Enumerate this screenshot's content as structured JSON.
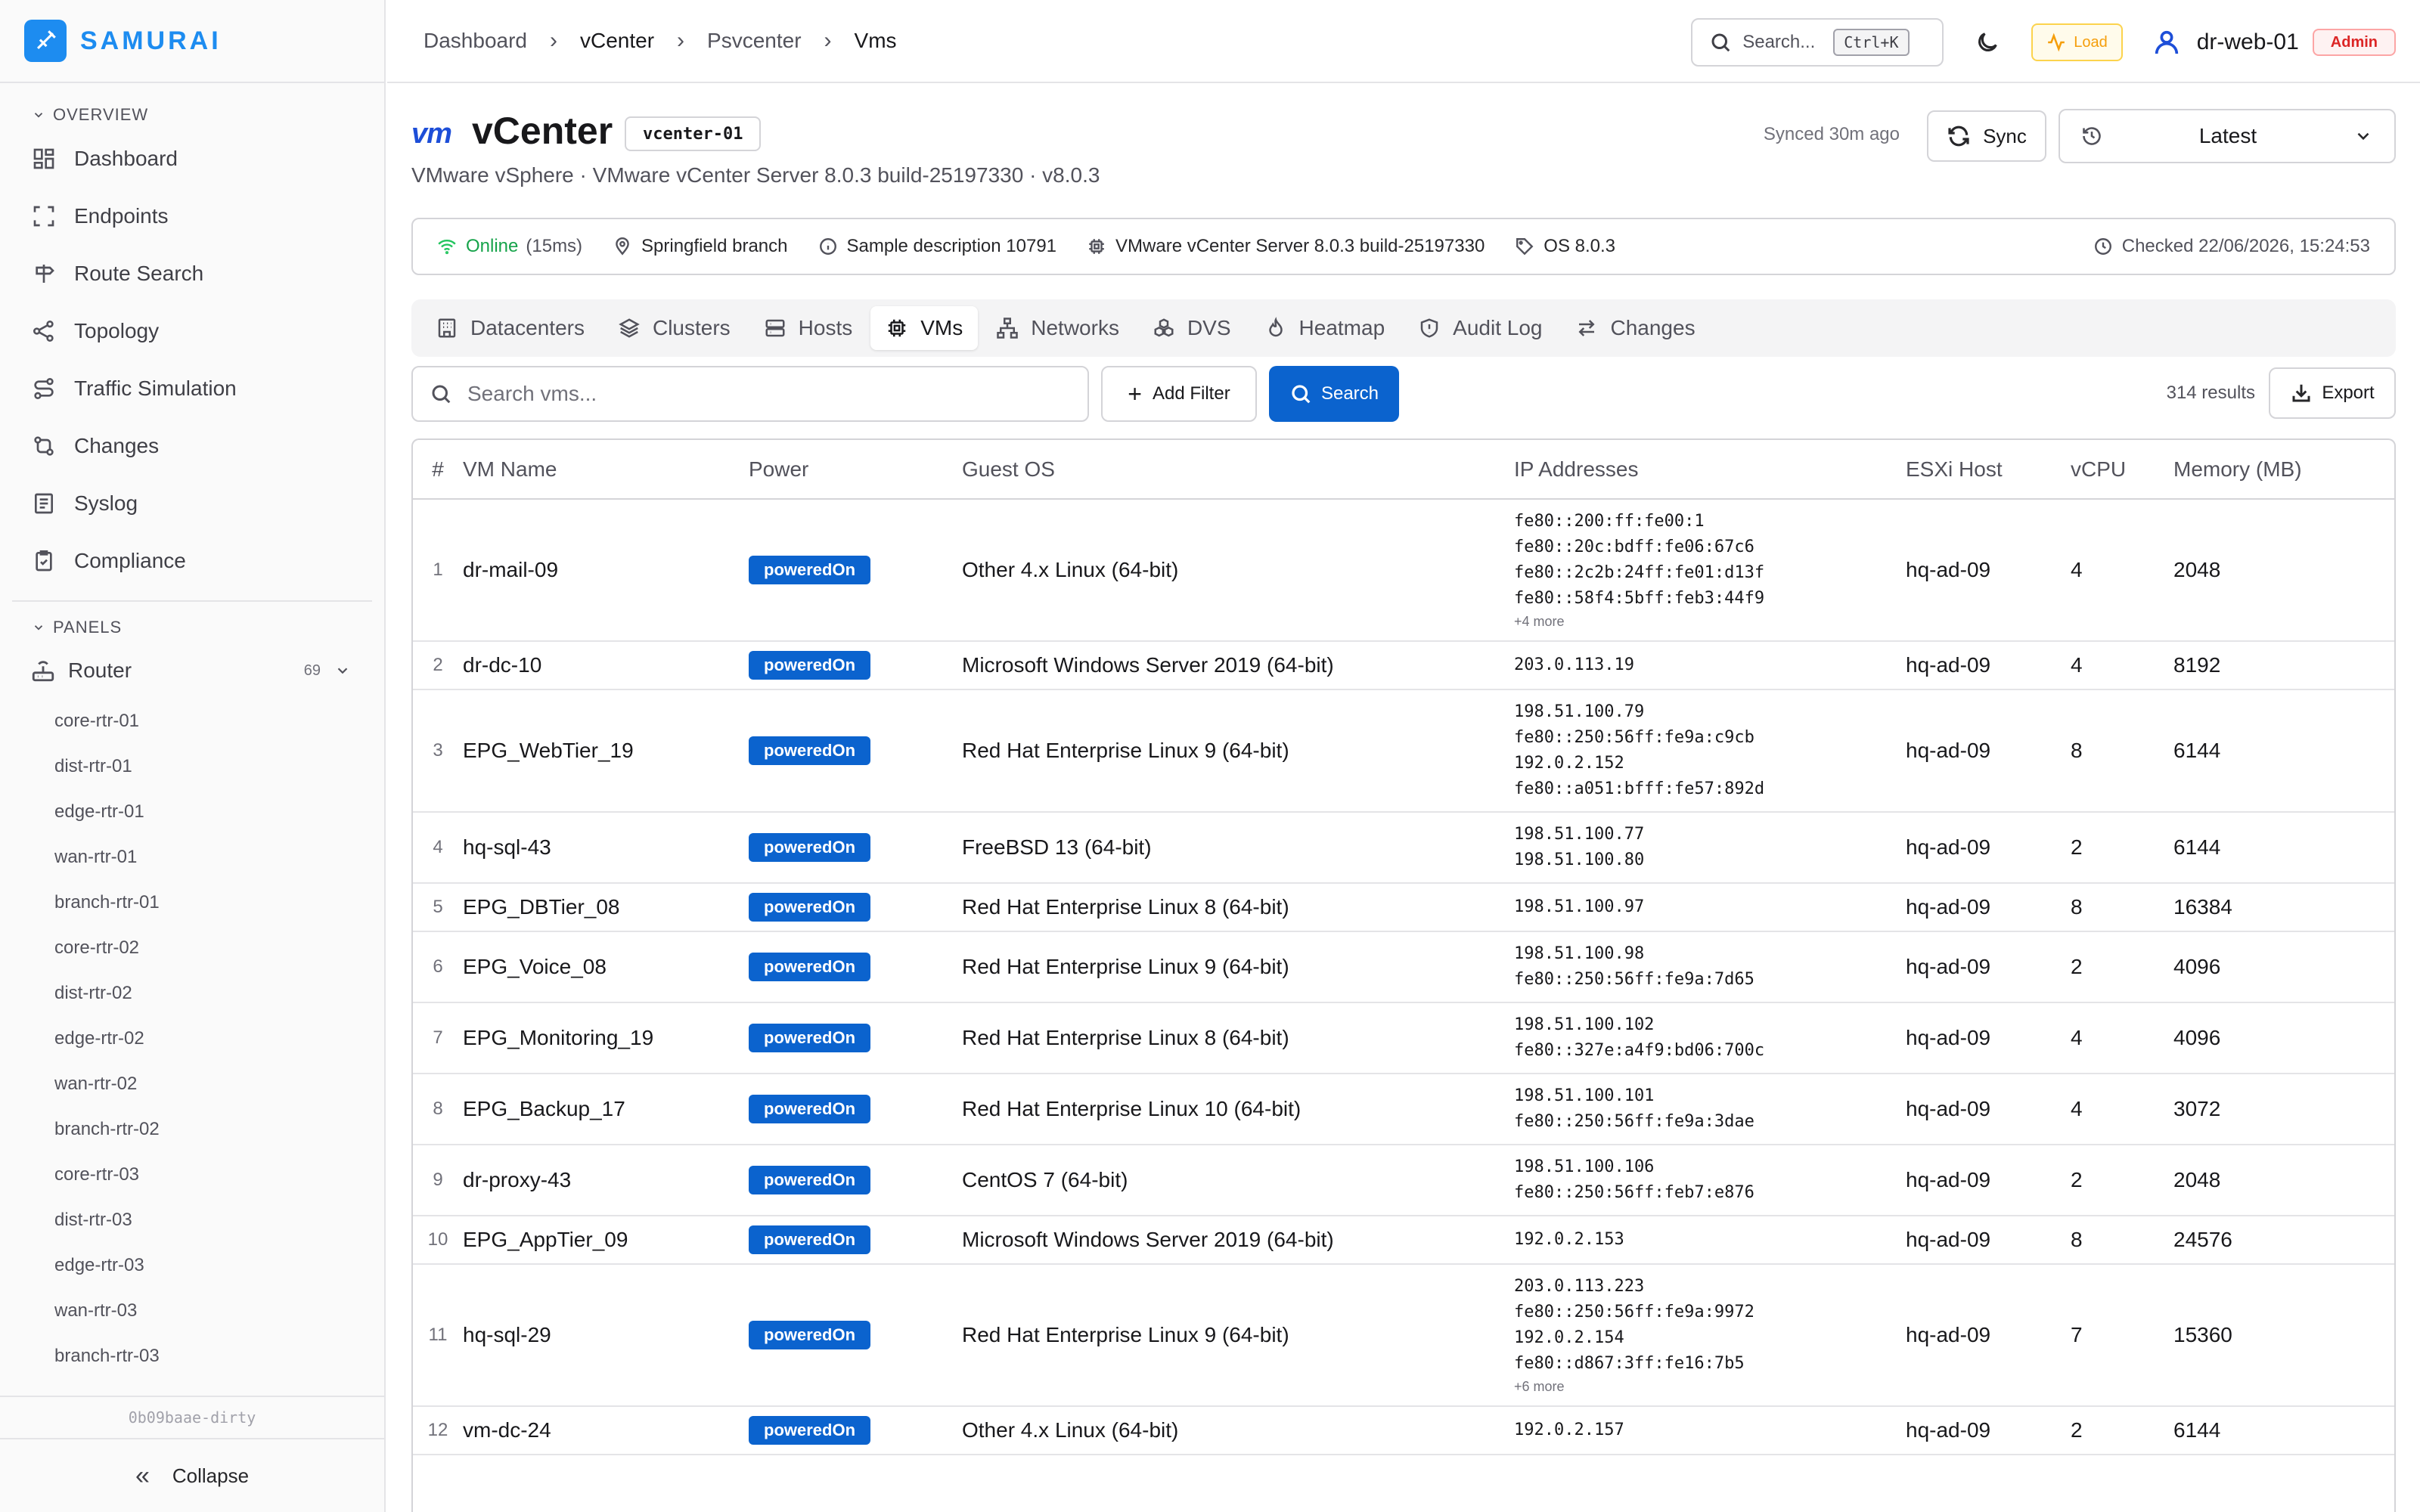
{
  "app": {
    "name": "SAMURAI",
    "version": "0b09baae-dirty",
    "collapse_label": "Collapse"
  },
  "sidebar": {
    "overview_label": "OVERVIEW",
    "panels_label": "PANELS",
    "items": [
      {
        "label": "Dashboard",
        "icon": "dashboard-icon"
      },
      {
        "label": "Endpoints",
        "icon": "endpoints-icon"
      },
      {
        "label": "Route Search",
        "icon": "signpost-icon"
      },
      {
        "label": "Topology",
        "icon": "topology-icon"
      },
      {
        "label": "Traffic Simulation",
        "icon": "route-icon"
      },
      {
        "label": "Changes",
        "icon": "git-compare-icon"
      },
      {
        "label": "Syslog",
        "icon": "log-icon"
      },
      {
        "label": "Compliance",
        "icon": "clipboard-check-icon"
      }
    ],
    "router": {
      "label": "Router",
      "count": "69",
      "items": [
        "core-rtr-01",
        "dist-rtr-01",
        "edge-rtr-01",
        "wan-rtr-01",
        "branch-rtr-01",
        "core-rtr-02",
        "dist-rtr-02",
        "edge-rtr-02",
        "wan-rtr-02",
        "branch-rtr-02",
        "core-rtr-03",
        "dist-rtr-03",
        "edge-rtr-03",
        "wan-rtr-03",
        "branch-rtr-03"
      ]
    }
  },
  "topbar": {
    "breadcrumb": [
      "Dashboard",
      "vCenter",
      "Psvcenter",
      "Vms"
    ],
    "search_label": "Search...",
    "search_kbd": "Ctrl+K",
    "load_label": "Load",
    "user_name": "dr-web-01",
    "user_role": "Admin"
  },
  "header": {
    "logo_text": "vm",
    "title": "vCenter",
    "id_badge": "vcenter-01",
    "subtitle": "VMware vSphere · VMware vCenter Server 8.0.3 build-25197330 · v8.0.3",
    "synced": "Synced 30m ago",
    "sync_label": "Sync",
    "version_select": "Latest"
  },
  "info": {
    "status": "Online",
    "latency": "(15ms)",
    "location": "Springfield branch",
    "description": "Sample description 10791",
    "product": "VMware vCenter Server 8.0.3 build-25197330",
    "os": "OS 8.0.3",
    "checked": "Checked 22/06/2026, 15:24:53"
  },
  "tabs": [
    {
      "label": "Datacenters",
      "icon": "building-icon"
    },
    {
      "label": "Clusters",
      "icon": "layers-icon"
    },
    {
      "label": "Hosts",
      "icon": "server-icon"
    },
    {
      "label": "VMs",
      "icon": "cpu-icon",
      "active": true
    },
    {
      "label": "Networks",
      "icon": "network-icon"
    },
    {
      "label": "DVS",
      "icon": "boxes-icon"
    },
    {
      "label": "Heatmap",
      "icon": "flame-icon"
    },
    {
      "label": "Audit Log",
      "icon": "shield-icon"
    },
    {
      "label": "Changes",
      "icon": "arrows-icon"
    }
  ],
  "filters": {
    "search_placeholder": "Search vms...",
    "add_filter_label": "Add Filter",
    "search_label": "Search",
    "results": "314 results",
    "export_label": "Export"
  },
  "table": {
    "columns": [
      "#",
      "VM Name",
      "Power",
      "Guest OS",
      "IP Addresses",
      "ESXi Host",
      "vCPU",
      "Memory (MB)"
    ],
    "rows": [
      {
        "n": "1",
        "name": "dr-mail-09",
        "power": "poweredOn",
        "os": "Other 4.x Linux (64-bit)",
        "ips": [
          "fe80::200:ff:fe00:1",
          "fe80::20c:bdff:fe06:67c6",
          "fe80::2c2b:24ff:fe01:d13f",
          "fe80::58f4:5bff:feb3:44f9"
        ],
        "more": "+4 more",
        "host": "hq-ad-09",
        "vcpu": "4",
        "mem": "2048"
      },
      {
        "n": "2",
        "name": "dr-dc-10",
        "power": "poweredOn",
        "os": "Microsoft Windows Server 2019 (64-bit)",
        "ips": [
          "203.0.113.19"
        ],
        "more": "",
        "host": "hq-ad-09",
        "vcpu": "4",
        "mem": "8192"
      },
      {
        "n": "3",
        "name": "EPG_WebTier_19",
        "power": "poweredOn",
        "os": "Red Hat Enterprise Linux 9 (64-bit)",
        "ips": [
          "198.51.100.79",
          "fe80::250:56ff:fe9a:c9cb",
          "192.0.2.152",
          "fe80::a051:bfff:fe57:892d"
        ],
        "more": "",
        "host": "hq-ad-09",
        "vcpu": "8",
        "mem": "6144"
      },
      {
        "n": "4",
        "name": "hq-sql-43",
        "power": "poweredOn",
        "os": "FreeBSD 13 (64-bit)",
        "ips": [
          "198.51.100.77",
          "198.51.100.80"
        ],
        "more": "",
        "host": "hq-ad-09",
        "vcpu": "2",
        "mem": "6144"
      },
      {
        "n": "5",
        "name": "EPG_DBTier_08",
        "power": "poweredOn",
        "os": "Red Hat Enterprise Linux 8 (64-bit)",
        "ips": [
          "198.51.100.97"
        ],
        "more": "",
        "host": "hq-ad-09",
        "vcpu": "8",
        "mem": "16384"
      },
      {
        "n": "6",
        "name": "EPG_Voice_08",
        "power": "poweredOn",
        "os": "Red Hat Enterprise Linux 9 (64-bit)",
        "ips": [
          "198.51.100.98",
          "fe80::250:56ff:fe9a:7d65"
        ],
        "more": "",
        "host": "hq-ad-09",
        "vcpu": "2",
        "mem": "4096"
      },
      {
        "n": "7",
        "name": "EPG_Monitoring_19",
        "power": "poweredOn",
        "os": "Red Hat Enterprise Linux 8 (64-bit)",
        "ips": [
          "198.51.100.102",
          "fe80::327e:a4f9:bd06:700c"
        ],
        "more": "",
        "host": "hq-ad-09",
        "vcpu": "4",
        "mem": "4096"
      },
      {
        "n": "8",
        "name": "EPG_Backup_17",
        "power": "poweredOn",
        "os": "Red Hat Enterprise Linux 10 (64-bit)",
        "ips": [
          "198.51.100.101",
          "fe80::250:56ff:fe9a:3dae"
        ],
        "more": "",
        "host": "hq-ad-09",
        "vcpu": "4",
        "mem": "3072"
      },
      {
        "n": "9",
        "name": "dr-proxy-43",
        "power": "poweredOn",
        "os": "CentOS 7 (64-bit)",
        "ips": [
          "198.51.100.106",
          "fe80::250:56ff:feb7:e876"
        ],
        "more": "",
        "host": "hq-ad-09",
        "vcpu": "2",
        "mem": "2048"
      },
      {
        "n": "10",
        "name": "EPG_AppTier_09",
        "power": "poweredOn",
        "os": "Microsoft Windows Server 2019 (64-bit)",
        "ips": [
          "192.0.2.153"
        ],
        "more": "",
        "host": "hq-ad-09",
        "vcpu": "8",
        "mem": "24576"
      },
      {
        "n": "11",
        "name": "hq-sql-29",
        "power": "poweredOn",
        "os": "Red Hat Enterprise Linux 9 (64-bit)",
        "ips": [
          "203.0.113.223",
          "fe80::250:56ff:fe9a:9972",
          "192.0.2.154",
          "fe80::d867:3ff:fe16:7b5"
        ],
        "more": "+6 more",
        "host": "hq-ad-09",
        "vcpu": "7",
        "mem": "15360"
      },
      {
        "n": "12",
        "name": "vm-dc-24",
        "power": "poweredOn",
        "os": "Other 4.x Linux (64-bit)",
        "ips": [
          "192.0.2.157"
        ],
        "more": "",
        "host": "hq-ad-09",
        "vcpu": "2",
        "mem": "6144"
      }
    ]
  }
}
